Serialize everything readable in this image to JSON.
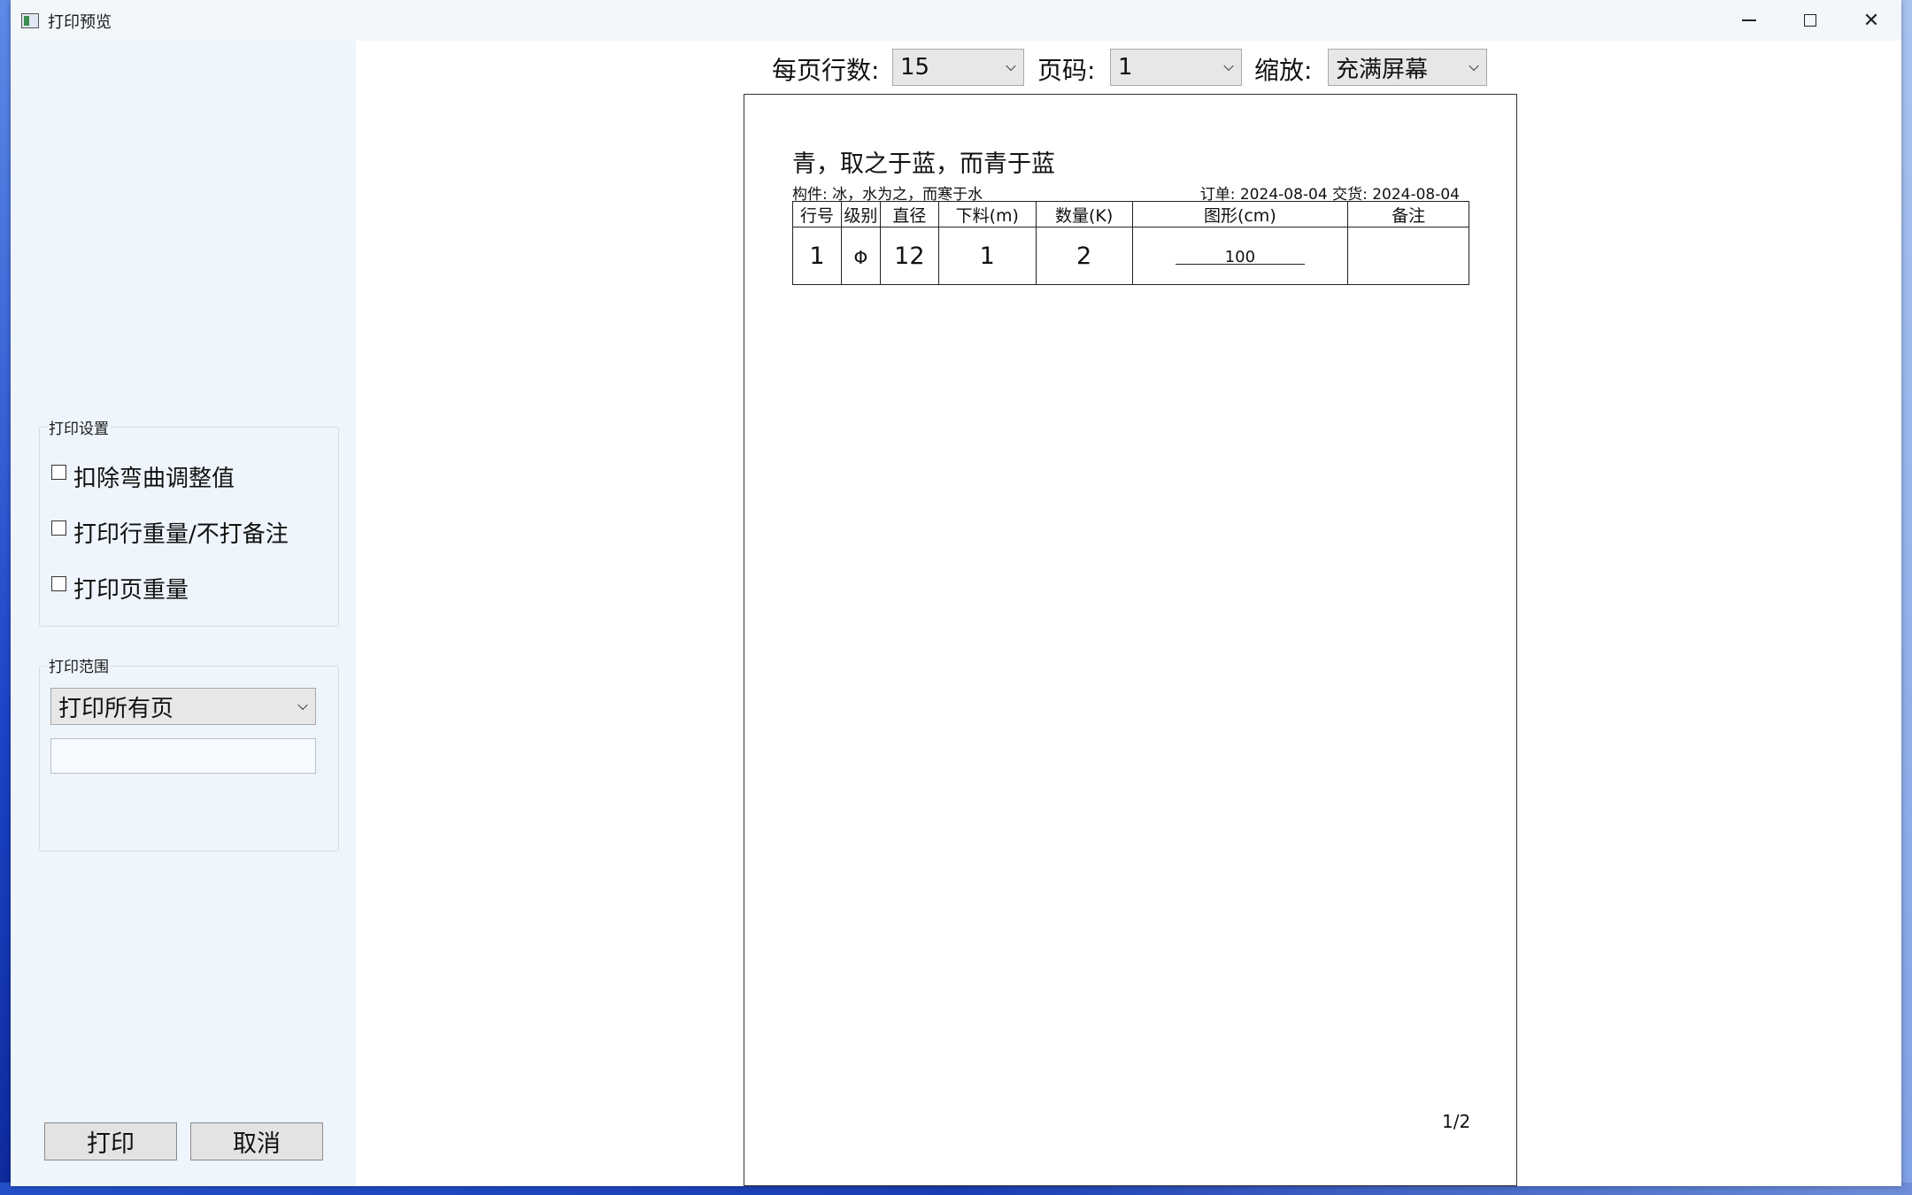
{
  "window": {
    "title": "打印预览"
  },
  "sidebar": {
    "print_settings": {
      "title": "打印设置",
      "options": [
        {
          "label": "扣除弯曲调整值",
          "checked": false
        },
        {
          "label": "打印行重量/不打备注",
          "checked": false
        },
        {
          "label": "打印页重量",
          "checked": false
        }
      ]
    },
    "print_range": {
      "title": "打印范围",
      "selected": "打印所有页",
      "input_value": ""
    },
    "buttons": {
      "print": "打印",
      "cancel": "取消"
    }
  },
  "toolbar": {
    "rows_per_page_label": "每页行数:",
    "rows_per_page_value": "15",
    "page_label": "页码:",
    "page_value": "1",
    "zoom_label": "缩放:",
    "zoom_value": "充满屏幕"
  },
  "document": {
    "title": "青，取之于蓝，而青于蓝",
    "member": "构件: 冰，水为之，而寒于水",
    "order": "订单: 2024-08-04 交货: 2024-08-04",
    "columns": [
      "行号",
      "级别",
      "直径",
      "下料(m)",
      "数量(K)",
      "图形(cm)",
      "备注"
    ],
    "rows": [
      {
        "line": "1",
        "grade": "Φ",
        "diameter": "12",
        "cut": "1",
        "qty": "2",
        "shape": "100",
        "note": ""
      }
    ],
    "page_indicator": "1/2"
  }
}
